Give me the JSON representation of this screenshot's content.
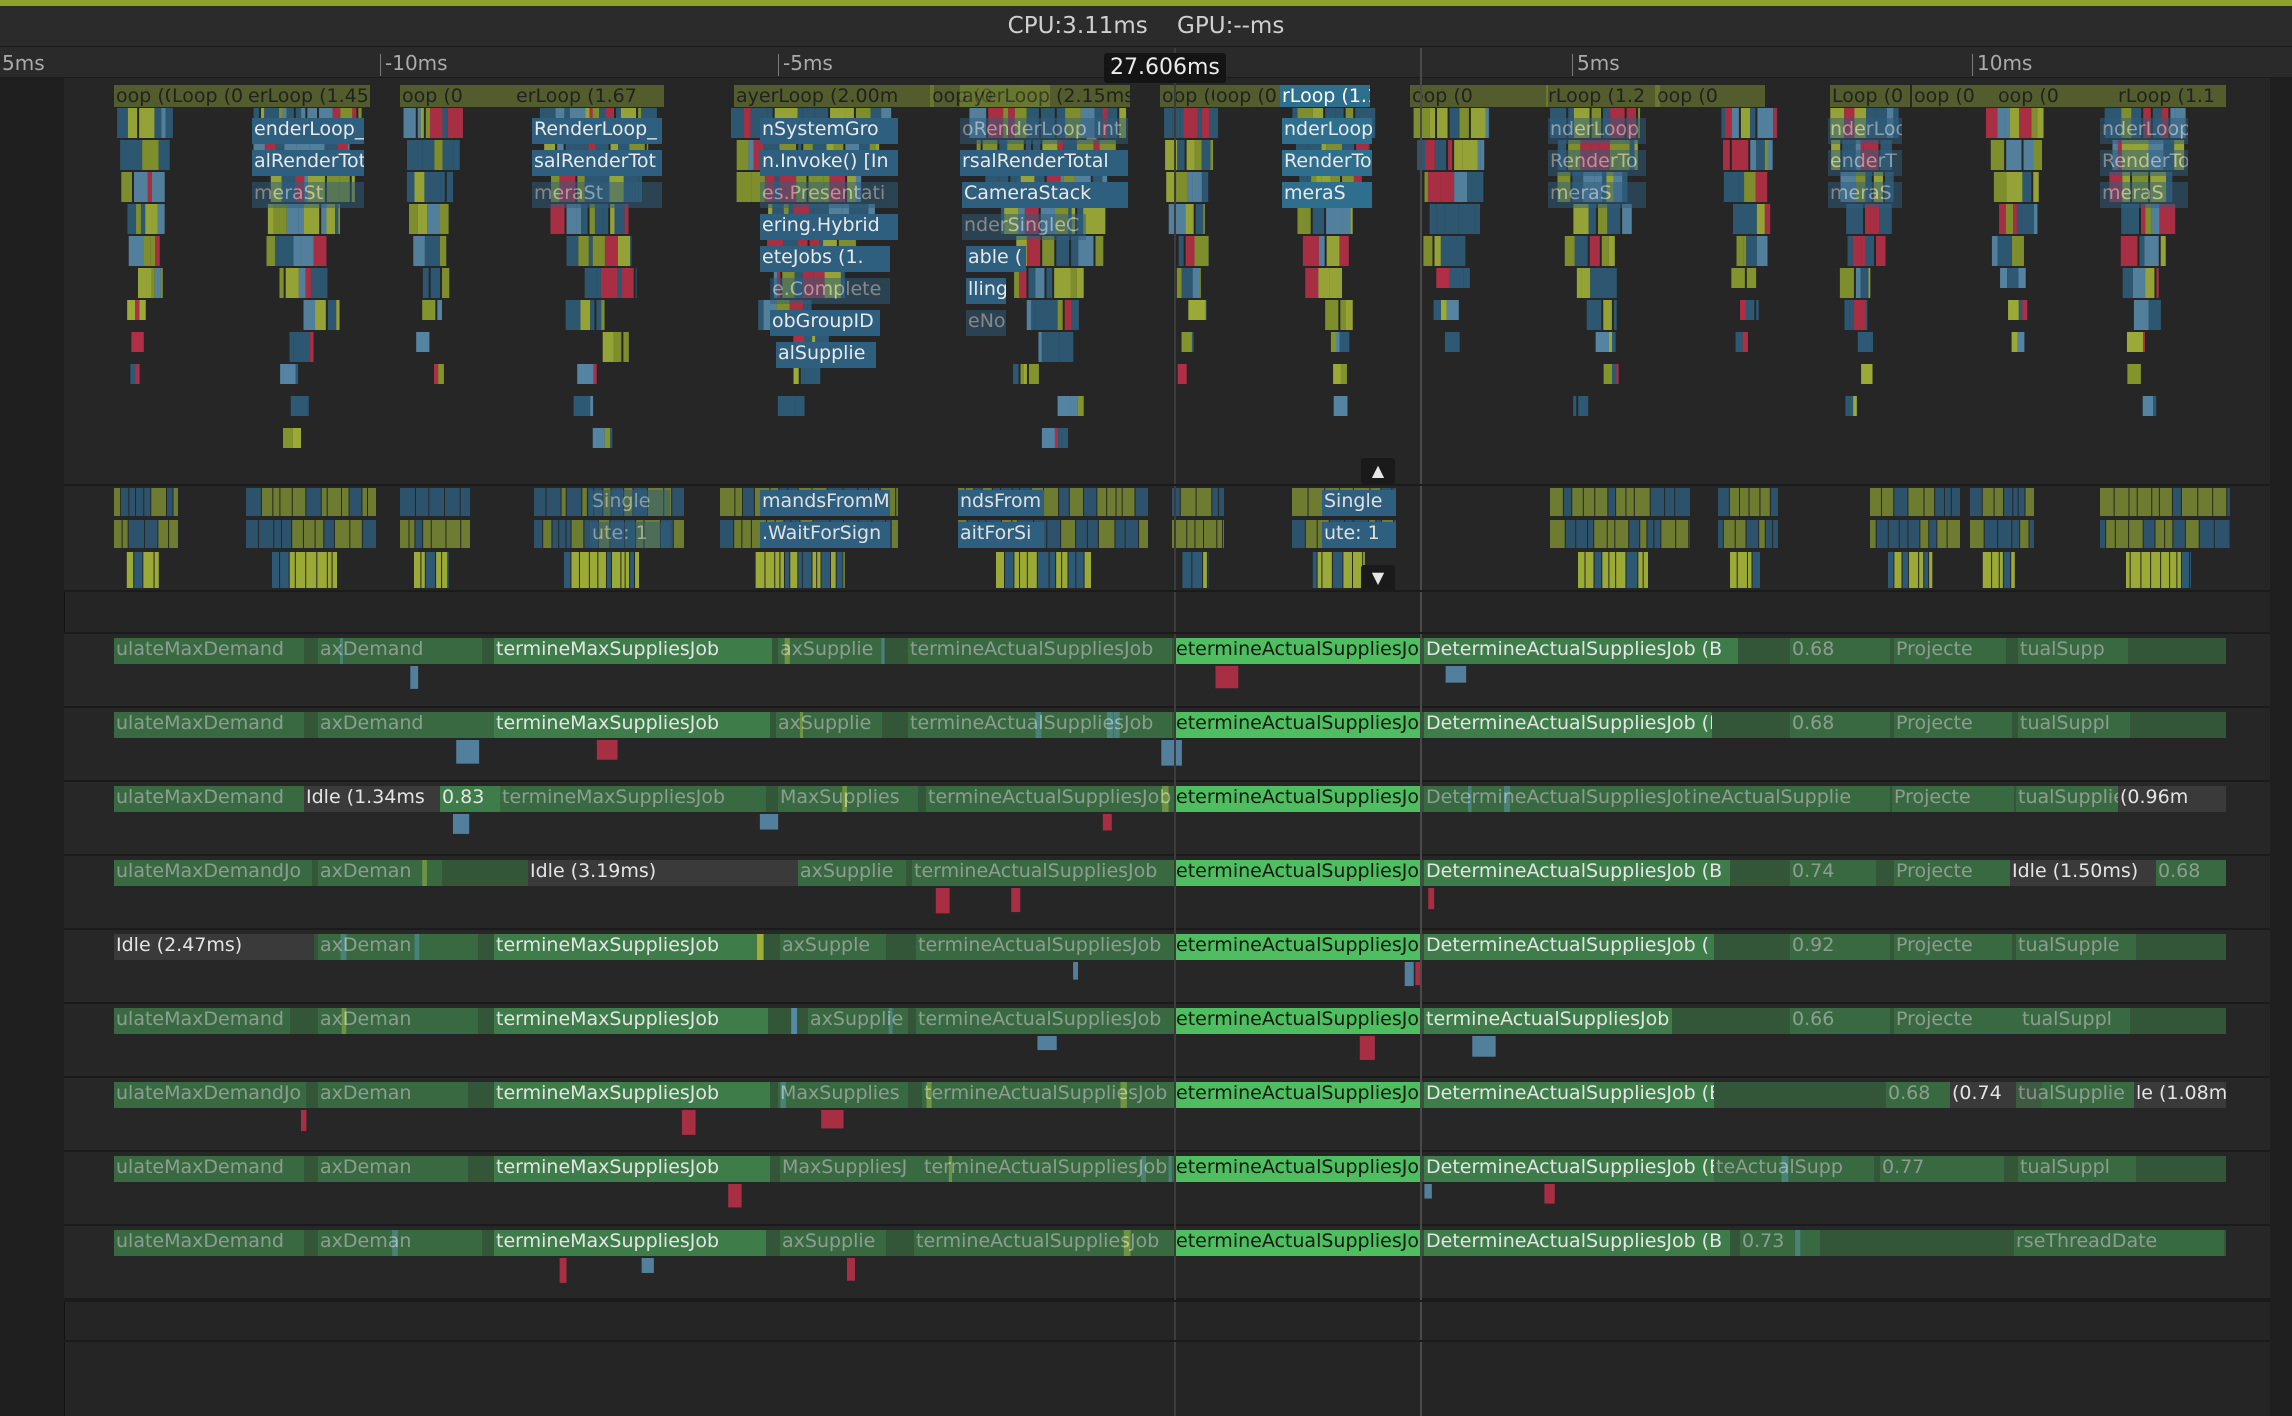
{
  "header": {
    "cpu_label": "CPU:3.11ms",
    "gpu_label": "GPU:--ms"
  },
  "timeline": {
    "tick_labels": [
      "5ms",
      "-10ms",
      "-5ms",
      "5ms",
      "10ms"
    ],
    "cursor_label": "27.606ms"
  },
  "main_thread": {
    "frame_labels": [
      "oop (0",
      "Loop (0",
      "erLoop (1.45",
      "oop (0",
      "erLoop (1.67",
      "ayerLoop (2.00m",
      "oop (0",
      "ayerLoop (2.15ms",
      "oop (0",
      "oop (0",
      "rLoop (1.1",
      "oop (0",
      "rLoop (1.2",
      "oop (0",
      "Loop (0",
      "oop (0",
      "oop (0",
      "rLoop (1.1"
    ],
    "text_labels": [
      "enderLoop_",
      "alRenderTot",
      "meraSt",
      "RenderLoop_",
      "salRenderTot",
      "meraSt",
      "nSystemGro",
      "n.Invoke() [In",
      "es.Presentati",
      "ering.Hybrid",
      "eteJobs (1.",
      "e.Complete",
      "obGroupID",
      "alSupplie",
      "oRenderLoop_Int",
      "rsalRenderTotal",
      "CameraStack",
      "nderSingleC",
      "able (",
      "lling",
      "eNod",
      "nderLoop",
      "RenderTo",
      "meraS",
      "nderLoop",
      "RenderTo",
      "meraS",
      "nderLoo",
      "enderT",
      "meraS",
      "nderLoop",
      "RenderTo",
      "meraS"
    ]
  },
  "render_thread": {
    "labels": [
      "Single",
      "ute: 1",
      "mandsFromM",
      ".WaitForSign",
      "ndsFrom",
      "aitForSi",
      "Single",
      "ute: 1"
    ]
  },
  "scroll": {
    "up_icon": "up-arrow-icon",
    "down_icon": "down-arrow-icon"
  },
  "worker_threads": [
    {
      "jobs": [
        "ulateMaxDemand",
        "axDemand",
        "termineMaxSuppliesJob",
        "axSupplie",
        "termineActualSuppliesJob",
        "etermineActualSuppliesJob",
        "DetermineActualSuppliesJob (B",
        "0.68",
        "Projecte",
        "tualSupp"
      ]
    },
    {
      "jobs": [
        "ulateMaxDemand",
        "axDemand",
        "termineMaxSuppliesJob",
        "axSupplie",
        "termineActualSuppliesJob",
        "etermineActualSuppliesJob",
        "DetermineActualSuppliesJob (B",
        "0.68",
        "Projecte",
        "tualSuppl"
      ]
    },
    {
      "jobs": [
        "ulateMaxDemand",
        "Idle (1.34ms",
        "0.83",
        "termineMaxSuppliesJob",
        "MaxSupplies",
        "termineActualSuppliesJob",
        "etermineActualSuppliesJob",
        "DetermineActualSuppliesJob (B",
        "ineActualSupplie",
        "Projecte",
        "tualSupplie",
        "(0.96m"
      ]
    },
    {
      "jobs": [
        "ulateMaxDemandJo",
        "axDeman",
        "Idle (3.19ms)",
        "axSupplie",
        "termineActualSuppliesJob",
        "etermineActualSuppliesJob",
        "DetermineActualSuppliesJob (B",
        "0.74",
        "Projecte",
        "Idle (1.50ms)",
        "0.68"
      ]
    },
    {
      "jobs": [
        "Idle (2.47ms)",
        "axDeman",
        "termineMaxSuppliesJob",
        "axSupple",
        "termineActualSuppliesJob",
        "etermineActualSuppliesJob",
        "DetermineActualSuppliesJob (",
        "0.92",
        "Projecte",
        "tualSupple"
      ]
    },
    {
      "jobs": [
        "ulateMaxDemand",
        "axDeman",
        "termineMaxSuppliesJob",
        "axSupplie",
        "termineActualSuppliesJob",
        "etermineActualSuppliesJob",
        "termineActualSuppliesJob",
        "0.66",
        "Projecte",
        "tualSuppl"
      ]
    },
    {
      "jobs": [
        "ulateMaxDemandJo",
        "axDeman",
        "termineMaxSuppliesJob",
        "MaxSupplies",
        "termineActualSuppliesJob",
        "etermineActualSuppliesJob",
        "DetermineActualSuppliesJob (B",
        "0.68",
        "(0.74",
        "tualSupplie",
        "le (1.08m"
      ]
    },
    {
      "jobs": [
        "ulateMaxDemand",
        "axDeman",
        "termineMaxSuppliesJob",
        "MaxSuppliesJ",
        "termineActualSuppliesJob",
        "etermineActualSuppliesJob",
        "DetermineActualSuppliesJob (B",
        "teActualSupp",
        "0.77",
        "tualSuppl"
      ]
    },
    {
      "jobs": [
        "ulateMaxDemand",
        "axDeman",
        "termineMaxSuppliesJob",
        "axSupplie",
        "termineActualSuppliesJob",
        "etermineActualSuppliesJob",
        "DetermineActualSuppliesJob (B",
        "0.73",
        "rseThreadDate"
      ]
    }
  ],
  "colors": {
    "job_green": "#3e7d49",
    "job_bright": "#4fbe60",
    "main_blue": "#2f5f7e",
    "main_green": "#8ea12f",
    "accent_red": "#c0304a",
    "idle_gray": "#3a3a3a"
  }
}
